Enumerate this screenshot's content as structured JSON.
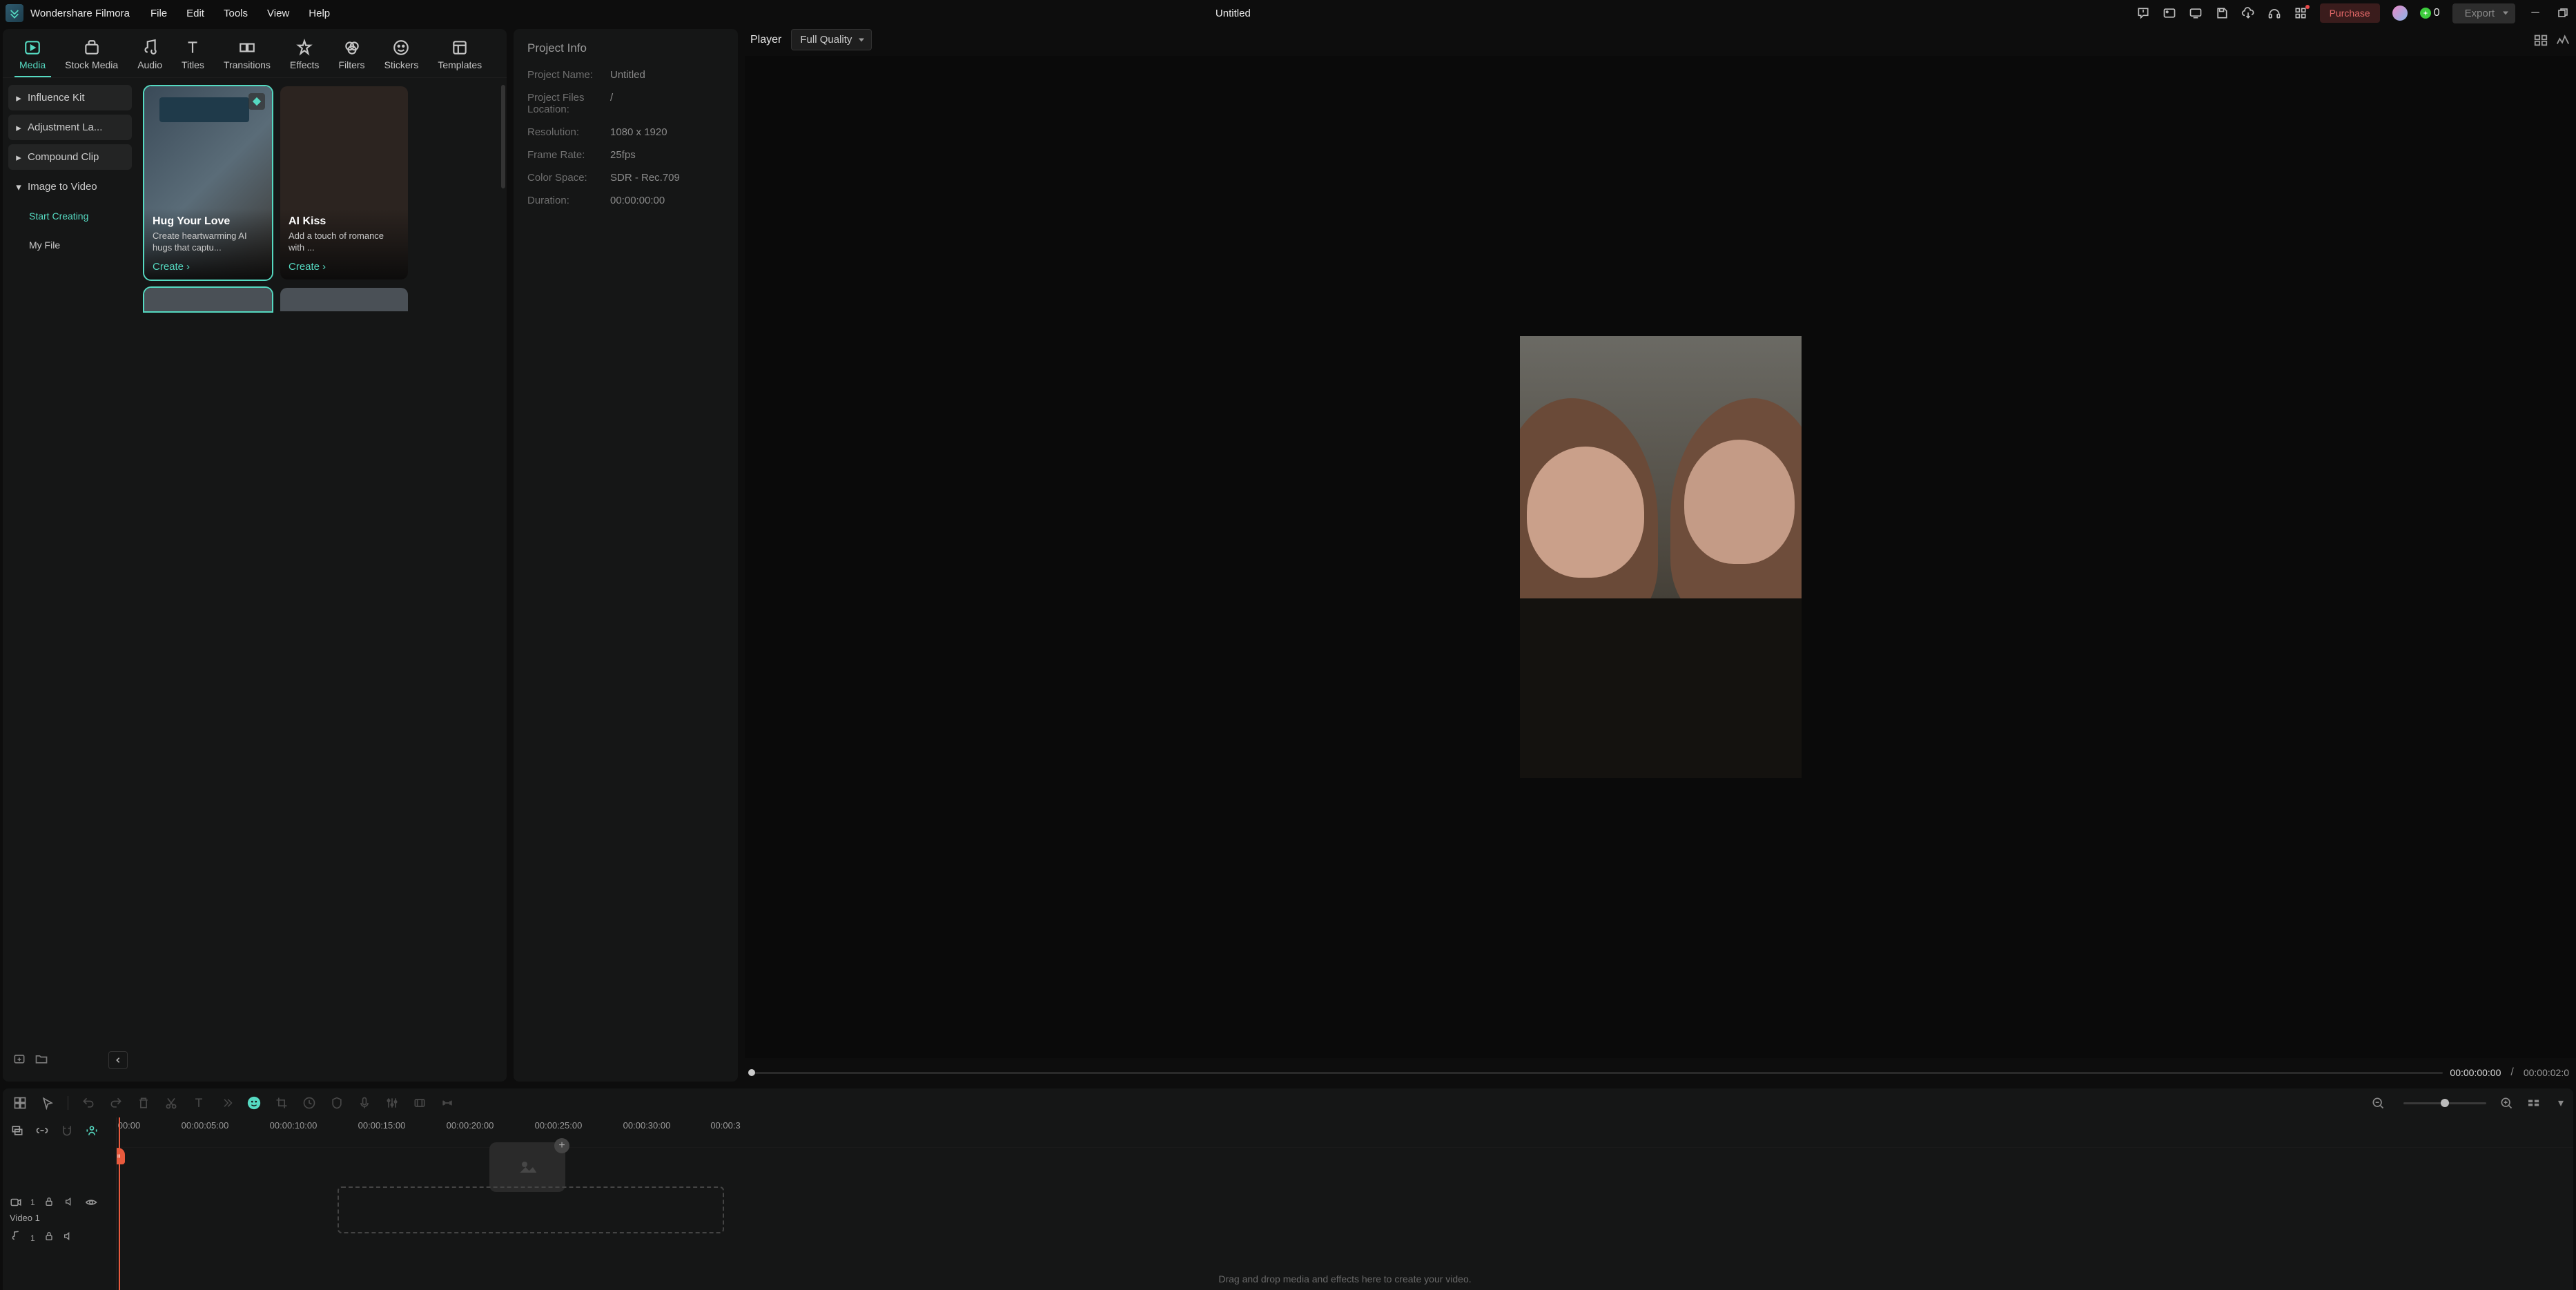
{
  "app": {
    "name": "Wondershare Filmora",
    "title": "Untitled"
  },
  "menubar": [
    "File",
    "Edit",
    "Tools",
    "View",
    "Help"
  ],
  "titlebar": {
    "purchase": "Purchase",
    "credits": "0",
    "export": "Export"
  },
  "top_tabs": [
    {
      "label": "Media",
      "active": true
    },
    {
      "label": "Stock Media"
    },
    {
      "label": "Audio"
    },
    {
      "label": "Titles"
    },
    {
      "label": "Transitions"
    },
    {
      "label": "Effects"
    },
    {
      "label": "Filters"
    },
    {
      "label": "Stickers"
    },
    {
      "label": "Templates"
    }
  ],
  "sidebar": {
    "items": [
      {
        "label": "Influence Kit",
        "expandable": true
      },
      {
        "label": "Adjustment La...",
        "expandable": true
      },
      {
        "label": "Compound Clip",
        "expandable": true
      },
      {
        "label": "Image to Video",
        "expandable": true,
        "expanded": true
      }
    ],
    "sub_items": [
      {
        "label": "Start Creating",
        "active": true
      },
      {
        "label": "My File"
      }
    ]
  },
  "cards": [
    {
      "title": "Hug Your Love",
      "desc": "Create heartwarming AI hugs that captu...",
      "cta": "Create",
      "selected": true
    },
    {
      "title": "AI Kiss",
      "desc": "Add a touch of romance with ...",
      "cta": "Create"
    }
  ],
  "project_info": {
    "header": "Project Info",
    "rows": [
      {
        "label": "Project Name:",
        "value": "Untitled"
      },
      {
        "label": "Project Files Location:",
        "value": "/"
      },
      {
        "label": "Resolution:",
        "value": "1080 x 1920"
      },
      {
        "label": "Frame Rate:",
        "value": "25fps"
      },
      {
        "label": "Color Space:",
        "value": "SDR - Rec.709"
      },
      {
        "label": "Duration:",
        "value": "00:00:00:00"
      }
    ]
  },
  "player": {
    "label": "Player",
    "quality": "Full Quality",
    "current_time": "00:00:00:00",
    "total_time": "00:00:02:0",
    "separator": "/"
  },
  "timeline": {
    "ruler": [
      "00:00",
      "00:00:05:00",
      "00:00:10:00",
      "00:00:15:00",
      "00:00:20:00",
      "00:00:25:00",
      "00:00:30:00",
      "00:00:3"
    ],
    "track_name": "Video 1",
    "drop_text": "Drag and drop media and effects here to create your video."
  }
}
